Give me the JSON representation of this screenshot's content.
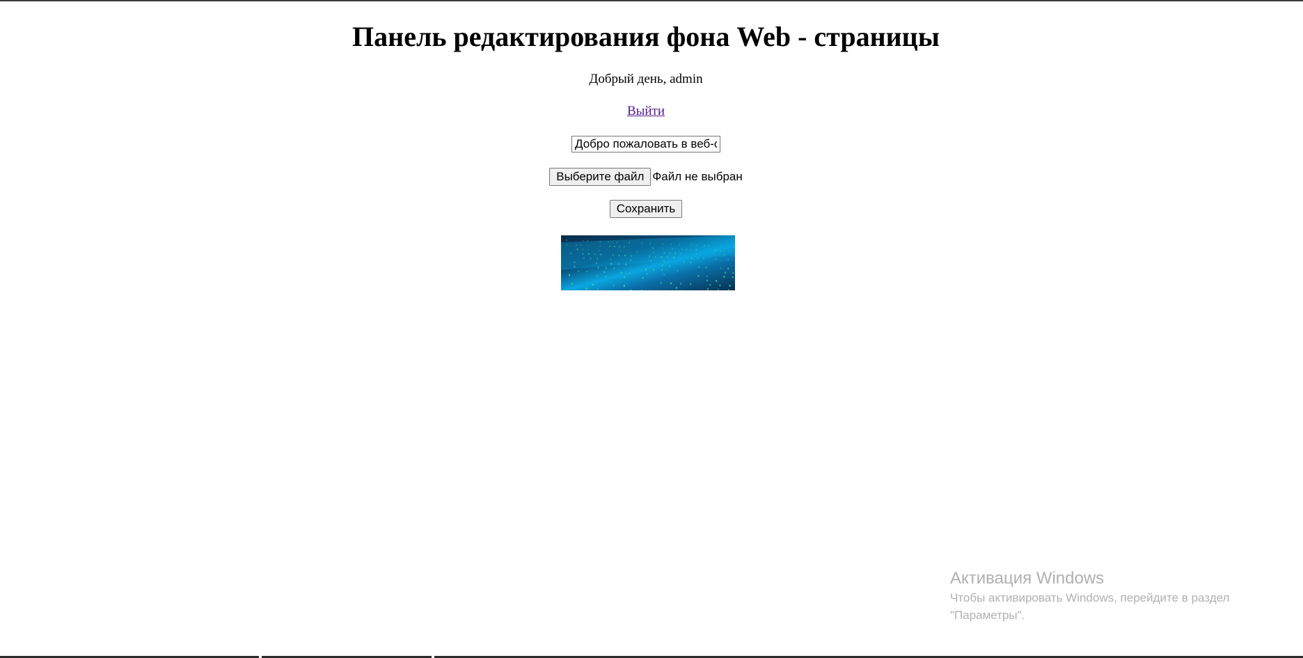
{
  "page": {
    "title": "Панель редактирования фона Web - страницы",
    "greeting": "Добрый день, admin",
    "logout_label": "Выйти"
  },
  "form": {
    "text_value": "Добро пожаловать в веб-с",
    "file_button_label": "Выберите файл",
    "file_status": "Файл не выбран",
    "save_label": "Сохранить"
  },
  "preview": {
    "icon": "background-image-preview",
    "colors": [
      "#0aa6e0",
      "#0b2c4a",
      "#3fe0a0"
    ]
  },
  "watermark": {
    "title": "Активация Windows",
    "line1": "Чтобы активировать Windows, перейдите в раздел",
    "line2": "\"Параметры\"."
  }
}
